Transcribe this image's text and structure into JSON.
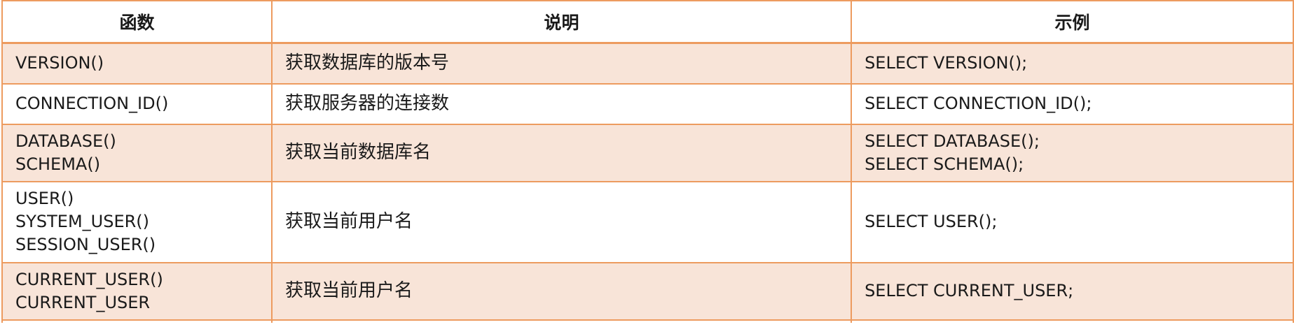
{
  "table": {
    "headers": [
      "函数",
      "说明",
      "示例"
    ],
    "rows": [
      {
        "functions": [
          "VERSION()"
        ],
        "description": "获取数据库的版本号",
        "examples": [
          "SELECT VERSION();"
        ]
      },
      {
        "functions": [
          "CONNECTION_ID()"
        ],
        "description": "获取服务器的连接数",
        "examples": [
          "SELECT CONNECTION_ID();"
        ]
      },
      {
        "functions": [
          "DATABASE()",
          "SCHEMA()"
        ],
        "description": "获取当前数据库名",
        "examples": [
          "SELECT DATABASE();",
          "SELECT SCHEMA();"
        ]
      },
      {
        "functions": [
          "USER()",
          "SYSTEM_USER()",
          "SESSION_USER()"
        ],
        "description": "获取当前用户名",
        "examples": [
          "SELECT USER();"
        ]
      },
      {
        "functions": [
          "CURRENT_USER()",
          "CURRENT_USER"
        ],
        "description": "获取当前用户名",
        "examples": [
          "SELECT CURRENT_USER;"
        ]
      }
    ]
  },
  "colors": {
    "border": "#ED9B5F",
    "row_shade": "#F8E4D8"
  }
}
